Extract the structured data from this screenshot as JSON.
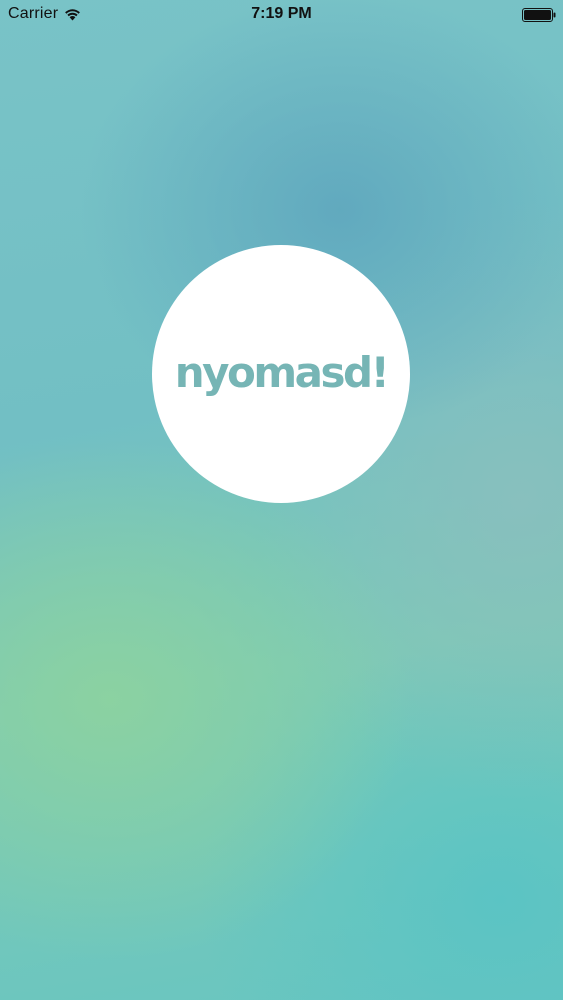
{
  "status_bar": {
    "carrier": "Carrier",
    "time": "7:19 PM",
    "wifi_icon": "wifi-icon",
    "battery_icon": "battery-icon",
    "battery_level": 1.0
  },
  "splash": {
    "logo_text": "nyomasd!",
    "logo_color": "#76b5b5",
    "circle_color": "#ffffff"
  },
  "colors": {
    "background_teal": "#72bfc4",
    "background_blue": "#60a8be",
    "background_green": "#8cd2a0"
  }
}
